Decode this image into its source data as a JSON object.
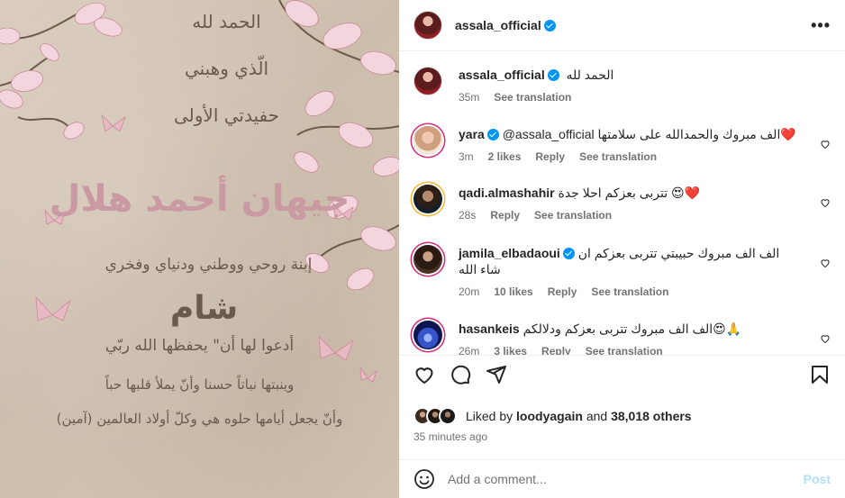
{
  "image_text": {
    "line1": "الحمد لله",
    "line2": "الّذي وهبني",
    "line3": "حفيدتي الأولى",
    "name": "جيهان أحمد هلال",
    "line5": "إبنة روحي ووطني ودنياي وفخري",
    "line6": "شام",
    "line7": "أدعوا لها أن\" يحفظها الله ربّي",
    "line8": "وينبتها نباتاً حسنا وأنّ يملأ قلبها حباً",
    "line9": "وأنّ يجعل أيامها حلوه هي وكلّ أولاد العالمين (آمين)"
  },
  "header": {
    "username": "assala_official",
    "more_icon": "more-horizontal-icon"
  },
  "caption": {
    "username": "assala_official",
    "text": "الحمد لله",
    "time": "35m",
    "see_translation": "See translation"
  },
  "comments": [
    {
      "username": "yara",
      "verified": true,
      "text": "@assala_official الف مبروك والحمدالله على سلامتها❤️",
      "time": "3m",
      "likes": "2 likes",
      "reply": "Reply",
      "see_translation": "See translation"
    },
    {
      "username": "qadi.almashahir",
      "verified": false,
      "text": "تتربى بعزكم احلا جدة 😍❤️",
      "time": "28s",
      "likes": "",
      "reply": "Reply",
      "see_translation": "See translation"
    },
    {
      "username": "jamila_elbadaoui",
      "verified": true,
      "text": "الف الف مبروك حبيبتي تتربى بعزكم ان شاء الله",
      "time": "20m",
      "likes": "10 likes",
      "reply": "Reply",
      "see_translation": "See translation"
    },
    {
      "username": "hasankeis",
      "verified": false,
      "text": "الف الف مبروك تتربى بعزكم ودلالكم😍🙏",
      "time": "26m",
      "likes": "3 likes",
      "reply": "Reply",
      "see_translation": "See translation"
    }
  ],
  "likes": {
    "prefix": "Liked by",
    "user": "loodyagain",
    "middle": "and",
    "count": "38,018 others"
  },
  "posted": "35 minutes ago",
  "add_comment": {
    "placeholder": "Add a comment...",
    "post": "Post"
  },
  "colors": {
    "accent": "#0095f6",
    "post_disabled": "#b2dffc",
    "secondary_text": "#737373",
    "mention": "#00376b",
    "image_bg": "#d4c5b5",
    "blossom": "#f3d6dd"
  }
}
